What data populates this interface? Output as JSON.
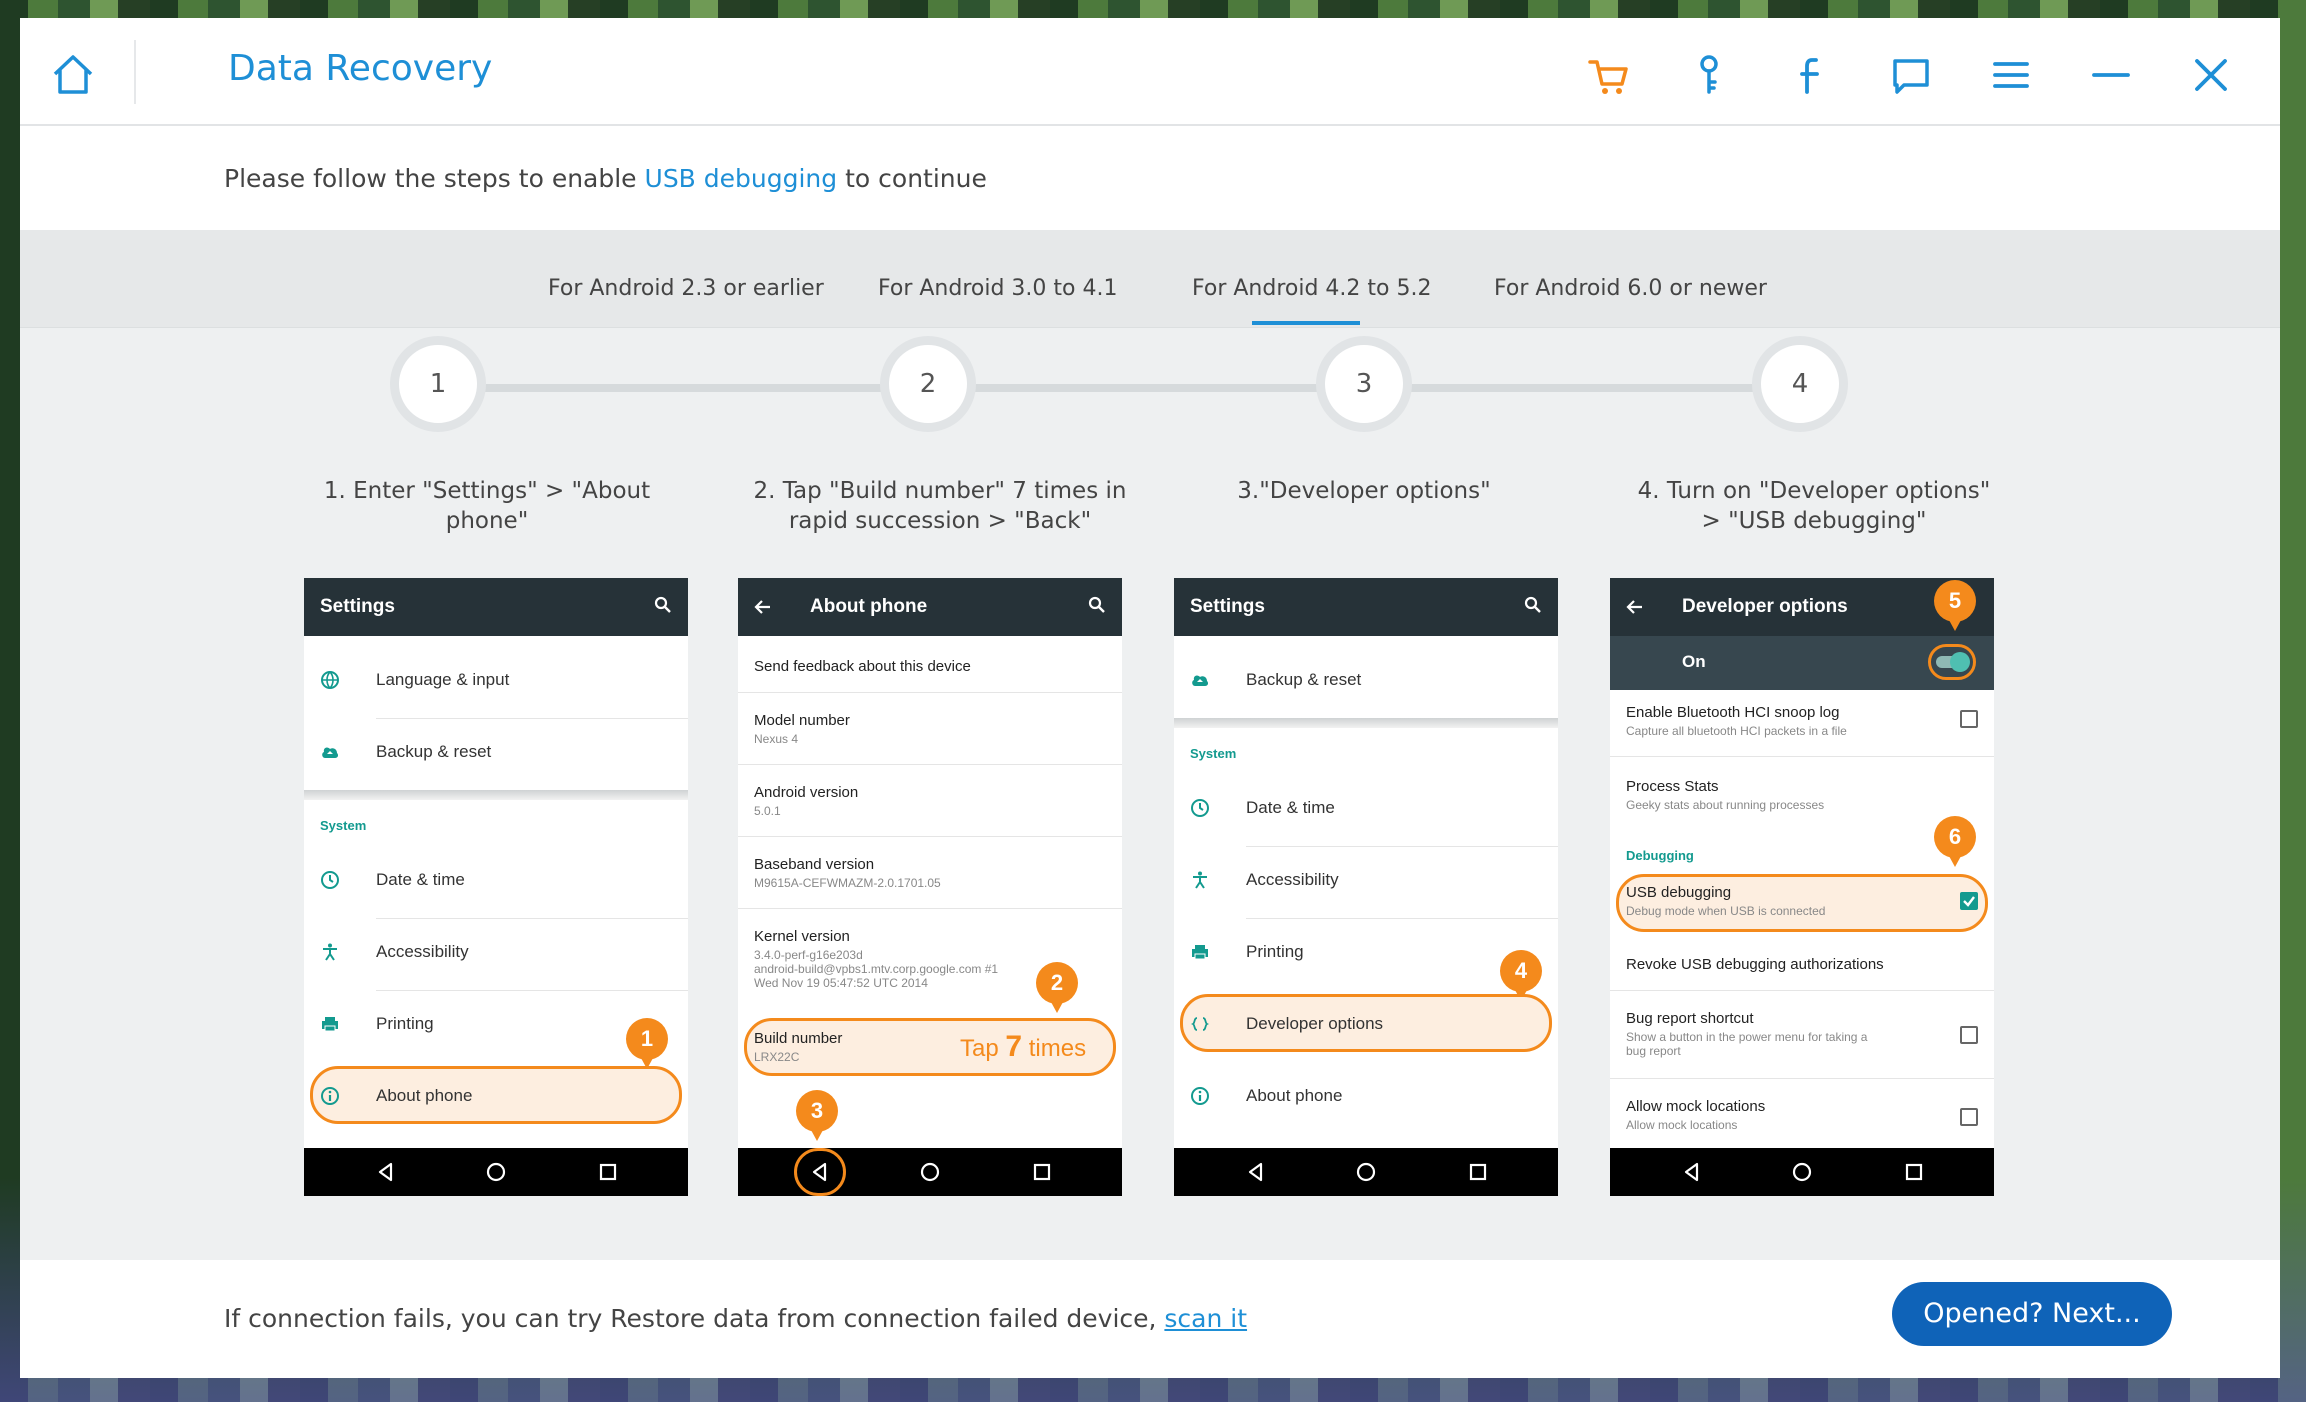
{
  "window": {
    "title": "Data Recovery",
    "icons": [
      "home-icon",
      "cart-icon",
      "key-icon",
      "facebook-icon",
      "feedback-icon",
      "menu-icon",
      "minimize-icon",
      "close-icon"
    ]
  },
  "instruction": {
    "prefix": "Please follow the steps to enable ",
    "link": "USB debugging",
    "suffix": " to continue"
  },
  "tabs": [
    {
      "label": "For Android 2.3 or earlier"
    },
    {
      "label": "For Android 3.0 to 4.1"
    },
    {
      "label": "For Android 4.2 to 5.2",
      "active": true
    },
    {
      "label": "For Android 6.0 or newer"
    }
  ],
  "steps": [
    {
      "num": "1",
      "caption": "1. Enter \"Settings\" > \"About phone\""
    },
    {
      "num": "2",
      "caption": "2. Tap \"Build number\" 7   times in\nrapid succession > \"Back\""
    },
    {
      "num": "3",
      "caption": "3.\"Developer options\""
    },
    {
      "num": "4",
      "caption": "4. Turn on \"Developer     options\"\n> \"USB debugging\""
    }
  ],
  "phone1": {
    "title": "Settings",
    "language": "Language & input",
    "backup": "Backup & reset",
    "system": "System",
    "datetime": "Date & time",
    "accessibility": "Accessibility",
    "printing": "Printing",
    "about": "About phone",
    "badge": "1"
  },
  "phone2": {
    "title": "About phone",
    "feedback": "Send feedback about this device",
    "model_label": "Model number",
    "model_value": "Nexus 4",
    "android_label": "Android version",
    "android_value": "5.0.1",
    "baseband_label": "Baseband version",
    "baseband_value": "M9615A-CEFWMAZM-2.0.1701.05",
    "kernel_label": "Kernel version",
    "kernel_value": "3.4.0-perf-g16e203d\nandroid-build@vpbs1.mtv.corp.google.com #1\nWed Nov 19 05:47:52 UTC 2014",
    "build_label": "Build number",
    "build_value": "LRX22C",
    "tap_prefix": "Tap ",
    "tap_num": "7",
    "tap_suffix": " times",
    "badge_build": "2",
    "badge_back": "3"
  },
  "phone3": {
    "title": "Settings",
    "backup": "Backup & reset",
    "system": "System",
    "datetime": "Date & time",
    "accessibility": "Accessibility",
    "printing": "Printing",
    "developer": "Developer options",
    "about": "About phone",
    "badge": "4"
  },
  "phone4": {
    "title": "Developer options",
    "on_label": "On",
    "bt_label": "Enable Bluetooth HCI snoop log",
    "bt_desc": "Capture all bluetooth HCI packets in a file",
    "stats_label": "Process Stats",
    "stats_desc": "Geeky stats about running processes",
    "debugging": "Debugging",
    "usb_label": "USB debugging",
    "usb_desc": "Debug mode when USB is connected",
    "revoke": "Revoke USB debugging authorizations",
    "bug_label": "Bug report shortcut",
    "bug_desc": "Show a button in the power menu for taking a\nbug report",
    "mock_label": "Allow mock locations",
    "mock_desc": "Allow mock locations",
    "badge_toggle": "5",
    "badge_usb": "6"
  },
  "footer": {
    "text": "If connection fails, you can try Restore data from connection failed device, ",
    "link": "scan it",
    "next_button": "Opened? Next..."
  },
  "colors": {
    "accent": "#1e8fd6",
    "orange": "#f48a1c",
    "teal": "#139a8f",
    "button": "#0f63b8"
  }
}
